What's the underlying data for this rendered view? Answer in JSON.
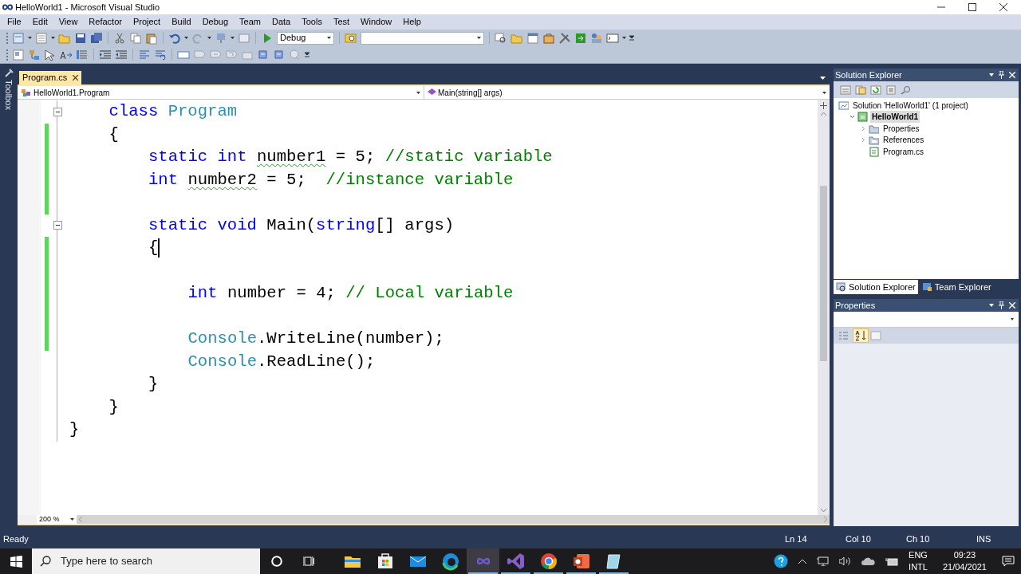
{
  "window": {
    "title": "HelloWorld1 - Microsoft Visual Studio"
  },
  "menu": [
    "File",
    "Edit",
    "View",
    "Refactor",
    "Project",
    "Build",
    "Debug",
    "Team",
    "Data",
    "Tools",
    "Test",
    "Window",
    "Help"
  ],
  "toolbar": {
    "configuration": "Debug"
  },
  "toolbox": {
    "label": "Toolbox"
  },
  "editor": {
    "tabs": [
      {
        "label": "Program.cs",
        "selected": true
      }
    ],
    "nav": {
      "type": "HelloWorld1.Program",
      "member": "Main(string[] args)"
    },
    "lines": [
      {
        "kind": "indent",
        "children": [
          {
            "kind": "line",
            "changed": false,
            "collapsible": true,
            "cursor": false,
            "tokens": [
              {
                "kind": "keyword",
                "text": "class "
              },
              {
                "kind": "type",
                "text": "Program"
              }
            ]
          },
          {
            "kind": "line",
            "changed": true,
            "collapsible": false,
            "cursor": false,
            "tokens": [
              {
                "kind": "plain",
                "text": "{"
              }
            ]
          },
          {
            "kind": "indent",
            "children": [
              {
                "kind": "line",
                "changed": true,
                "collapsible": false,
                "cursor": false,
                "tokens": [
                  {
                    "kind": "keyword",
                    "text": "static int "
                  },
                  {
                    "kind": "warning",
                    "text": "number1"
                  },
                  {
                    "kind": "plain",
                    "text": " = 5; "
                  },
                  {
                    "kind": "comment",
                    "text": "//static variable"
                  }
                ]
              },
              {
                "kind": "line",
                "changed": true,
                "collapsible": false,
                "cursor": false,
                "tokens": [
                  {
                    "kind": "keyword",
                    "text": "int "
                  },
                  {
                    "kind": "warning",
                    "text": "number2"
                  },
                  {
                    "kind": "plain",
                    "text": " = 5;  "
                  },
                  {
                    "kind": "comment",
                    "text": "//instance variable"
                  }
                ]
              },
              {
                "kind": "line",
                "changed": true,
                "collapsible": false,
                "cursor": false
              },
              {
                "kind": "line",
                "changed": false,
                "collapsible": true,
                "cursor": false,
                "tokens": [
                  {
                    "kind": "keyword",
                    "text": "static void "
                  },
                  {
                    "kind": "plain",
                    "text": "Main("
                  },
                  {
                    "kind": "keyword",
                    "text": "string"
                  },
                  {
                    "kind": "plain",
                    "text": "[] args)"
                  }
                ]
              },
              {
                "kind": "line",
                "changed": true,
                "collapsible": false,
                "cursor": true,
                "tokens": [
                  {
                    "kind": "plain",
                    "text": "{"
                  }
                ]
              },
              {
                "kind": "indent",
                "children": [
                  {
                    "kind": "line",
                    "changed": true,
                    "collapsible": false,
                    "cursor": false
                  },
                  {
                    "kind": "line",
                    "changed": true,
                    "collapsible": false,
                    "cursor": false,
                    "tokens": [
                      {
                        "kind": "keyword",
                        "text": "int "
                      },
                      {
                        "kind": "plain",
                        "text": "number = 4; "
                      },
                      {
                        "kind": "comment",
                        "text": "// Local variable"
                      }
                    ]
                  },
                  {
                    "kind": "line",
                    "changed": true,
                    "collapsible": false,
                    "cursor": false
                  },
                  {
                    "kind": "line",
                    "changed": true,
                    "collapsible": false,
                    "cursor": false,
                    "tokens": [
                      {
                        "kind": "type",
                        "text": "Console"
                      },
                      {
                        "kind": "plain",
                        "text": ".WriteLine(number);"
                      }
                    ]
                  },
                  {
                    "kind": "line",
                    "changed": false,
                    "collapsible": false,
                    "cursor": false,
                    "tokens": [
                      {
                        "kind": "type",
                        "text": "Console"
                      },
                      {
                        "kind": "plain",
                        "text": ".ReadLine();"
                      }
                    ]
                  }
                ]
              },
              {
                "kind": "line",
                "changed": false,
                "collapsible": false,
                "cursor": false,
                "tokens": [
                  {
                    "kind": "plain",
                    "text": "}"
                  }
                ]
              }
            ]
          },
          {
            "kind": "line",
            "changed": false,
            "collapsible": false,
            "cursor": false,
            "tokens": [
              {
                "kind": "plain",
                "text": "}"
              }
            ]
          }
        ]
      },
      {
        "kind": "line",
        "changed": false,
        "collapsible": false,
        "cursor": false,
        "tokens": [
          {
            "kind": "plain",
            "text": "}"
          }
        ]
      }
    ],
    "zoom": "200 %"
  },
  "solution_explorer": {
    "title": "Solution Explorer",
    "tree": [
      {
        "kind": "solution",
        "label": "Solution 'HelloWorld1' (1 project)",
        "selected": false,
        "children": [
          {
            "kind": "project",
            "label": "HelloWorld1",
            "selected": true,
            "expanded": true,
            "children": [
              {
                "kind": "folder",
                "label": "Properties",
                "selected": false,
                "expanded": false
              },
              {
                "kind": "references",
                "label": "References",
                "selected": false,
                "expanded": false
              },
              {
                "kind": "file",
                "label": "Program.cs",
                "selected": false
              }
            ]
          }
        ]
      }
    ]
  },
  "panel_tabs": [
    {
      "label": "Solution Explorer",
      "selected": true
    },
    {
      "label": "Team Explorer",
      "selected": false
    }
  ],
  "properties": {
    "title": "Properties",
    "alphabetical": true
  },
  "status_bar": {
    "message": "Ready",
    "line": "Ln 14",
    "col": "Col 10",
    "ch": "Ch 10",
    "mode": "INS"
  },
  "taskbar": {
    "search_placeholder": "Type here to search",
    "apps": [
      {
        "kind": "explorer",
        "active": false,
        "running": false
      },
      {
        "kind": "store",
        "active": false,
        "running": false
      },
      {
        "kind": "mail",
        "active": false,
        "running": false
      },
      {
        "kind": "edge",
        "active": false,
        "running": false
      },
      {
        "kind": "vs-old",
        "active": true,
        "running": true
      },
      {
        "kind": "vs",
        "active": false,
        "running": true
      },
      {
        "kind": "chrome",
        "active": false,
        "running": true
      },
      {
        "kind": "powerpoint",
        "active": false,
        "running": true
      },
      {
        "kind": "notepad",
        "active": false,
        "running": true
      }
    ]
  },
  "tray": {
    "language": "ENG",
    "layout": "INTL",
    "time": "09:23",
    "date": "21/04/2021"
  }
}
